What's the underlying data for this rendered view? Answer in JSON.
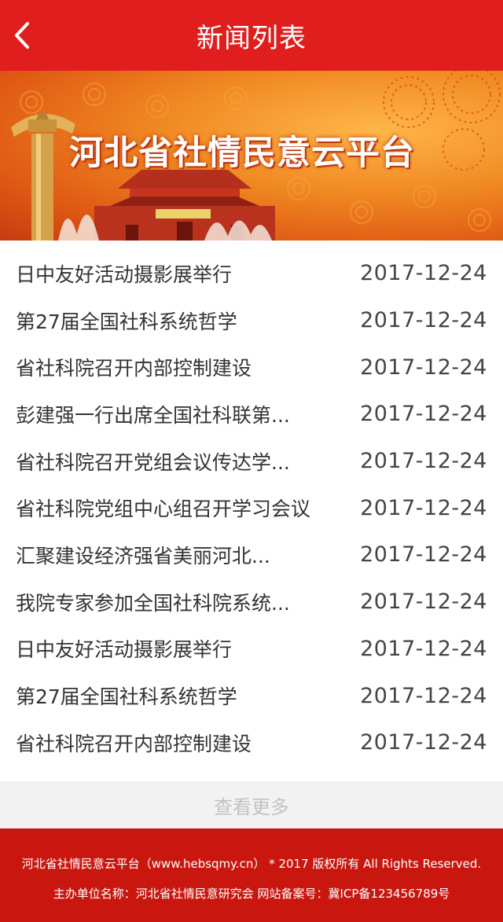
{
  "header": {
    "title": "新闻列表",
    "back_icon": "chevron-left-icon",
    "background": "#e01e1e"
  },
  "banner": {
    "title": "河北省社情民意云平台"
  },
  "news": [
    {
      "title": "日中友好活动摄影展举行",
      "date": "2017-12-24"
    },
    {
      "title": "第27届全国社科系统哲学",
      "date": "2017-12-24"
    },
    {
      "title": "省社科院召开内部控制建设",
      "date": "2017-12-24"
    },
    {
      "title": "彭建强一行出席全国社科联第...",
      "date": "2017-12-24"
    },
    {
      "title": "省社科院召开党组会议传达学...",
      "date": "2017-12-24"
    },
    {
      "title": "省社科院党组中心组召开学习会议",
      "date": "2017-12-24"
    },
    {
      "title": "汇聚建设经济强省美丽河北...",
      "date": "2017-12-24"
    },
    {
      "title": "我院专家参加全国社科院系统...",
      "date": "2017-12-24"
    },
    {
      "title": "日中友好活动摄影展举行",
      "date": "2017-12-24"
    },
    {
      "title": "第27届全国社科系统哲学",
      "date": "2017-12-24"
    },
    {
      "title": "省社科院召开内部控制建设",
      "date": "2017-12-24"
    }
  ],
  "more": {
    "label": "查看更多"
  },
  "footer": {
    "line1": "河北省社情民意云平台（www.hebsqmy.cn） * 2017 版权所有 All Rights Reserved.",
    "line2": "主办单位名称：河北省社情民意研究会   网站备案号：冀ICP备123456789号",
    "background": "#c9170f"
  }
}
